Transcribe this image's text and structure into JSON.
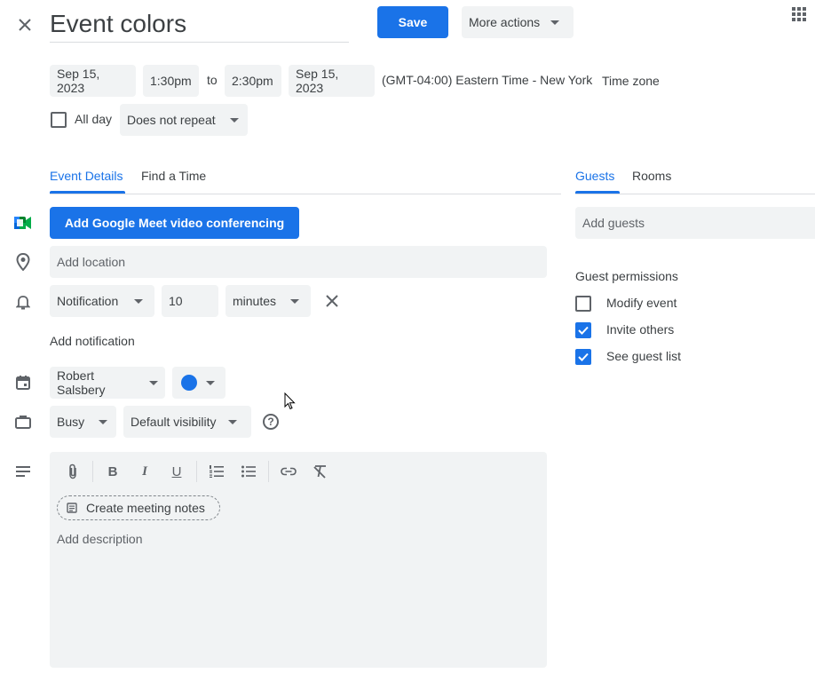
{
  "header": {
    "title": "Event colors",
    "save_label": "Save",
    "more_actions_label": "More actions"
  },
  "datetime": {
    "start_date": "Sep 15, 2023",
    "start_time": "1:30pm",
    "to_label": "to",
    "end_time": "2:30pm",
    "end_date": "Sep 15, 2023",
    "timezone_text": "(GMT-04:00) Eastern Time - New York",
    "timezone_link": "Time zone",
    "all_day_label": "All day",
    "repeat_value": "Does not repeat"
  },
  "tabs": {
    "event_details": "Event Details",
    "find_a_time": "Find a Time",
    "guests": "Guests",
    "rooms": "Rooms"
  },
  "details": {
    "meet_button": "Add Google Meet video conferencing",
    "location_placeholder": "Add location",
    "notification_type": "Notification",
    "notification_value": "10",
    "notification_unit": "minutes",
    "add_notification": "Add notification",
    "calendar_owner": "Robert Salsbery",
    "event_color": "#1a73e8",
    "busy_value": "Busy",
    "visibility_value": "Default visibility",
    "create_notes_label": "Create meeting notes",
    "description_placeholder": "Add description"
  },
  "guests": {
    "add_guests_placeholder": "Add guests",
    "permissions_title": "Guest permissions",
    "permissions": [
      {
        "label": "Modify event",
        "checked": false
      },
      {
        "label": "Invite others",
        "checked": true
      },
      {
        "label": "See guest list",
        "checked": true
      }
    ]
  },
  "colors": {
    "accent": "#1a73e8",
    "chip_bg": "#f1f3f4"
  }
}
